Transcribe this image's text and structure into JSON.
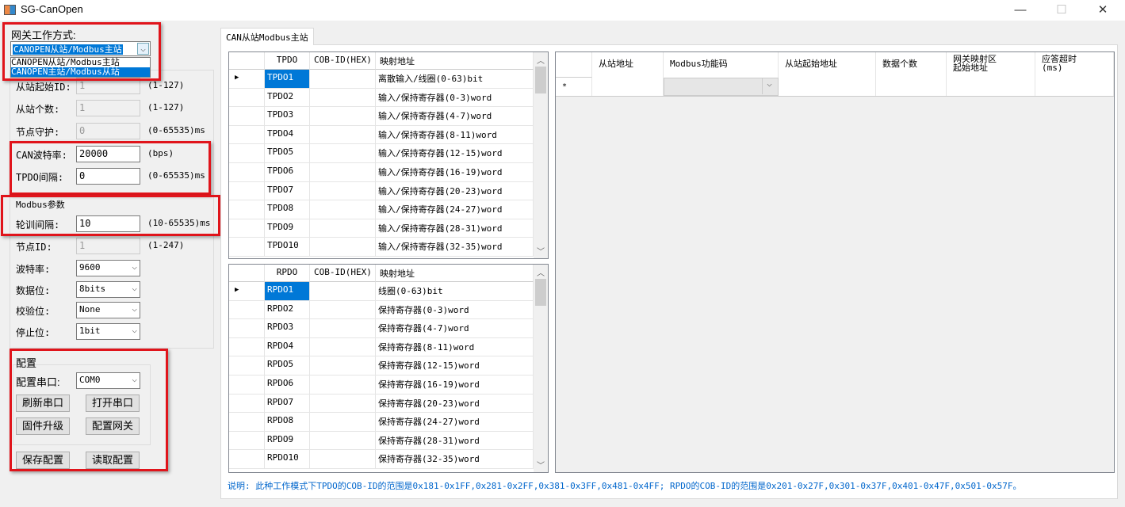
{
  "window": {
    "title": "SG-CanOpen",
    "minimize": "—",
    "maximize": "☐",
    "close": "✕"
  },
  "left": {
    "work_mode_label": "网关工作方式:",
    "work_mode_value": "CANOPEN从站/Modbus主站",
    "work_mode_options": [
      "CANOPEN从站/Modbus主站",
      "CANOPEN主站/Modbus从站"
    ],
    "can_fields": [
      {
        "label": "从站起始ID:",
        "value": "1",
        "range": "(1-127)",
        "disabled": true
      },
      {
        "label": "从站个数:",
        "value": "1",
        "range": "(1-127)",
        "disabled": true
      },
      {
        "label": "节点守护:",
        "value": "0",
        "range": "(0-65535)ms",
        "disabled": true
      },
      {
        "label": "CAN波特率:",
        "value": "20000",
        "range": "(bps)",
        "disabled": false
      },
      {
        "label": "TPDO间隔:",
        "value": "0",
        "range": "(0-65535)ms",
        "disabled": false
      }
    ],
    "modbus_title": "Modbus参数",
    "modbus_fields": [
      {
        "label": "轮训间隔:",
        "value": "10",
        "range": "(10-65535)ms",
        "disabled": false
      },
      {
        "label": "节点ID:",
        "value": "1",
        "range": "(1-247)",
        "disabled": true
      }
    ],
    "modbus_combos": [
      {
        "label": "波特率:",
        "value": "9600"
      },
      {
        "label": "数据位:",
        "value": "8bits"
      },
      {
        "label": "校验位:",
        "value": "None"
      },
      {
        "label": "停止位:",
        "value": "1bit"
      }
    ],
    "config": {
      "title": "配置",
      "port_label": "配置串口:",
      "port_value": "COM0",
      "refresh": "刷新串口",
      "open": "打开串口",
      "upgrade": "固件升级",
      "config_gateway": "配置网关",
      "save": "保存配置",
      "read": "读取配置"
    }
  },
  "tab": {
    "label": "CAN从站Modbus主站"
  },
  "tpdo": {
    "headers": [
      "TPDO",
      "COB-ID(HEX)",
      "映射地址"
    ],
    "rows": [
      [
        "TPDO1",
        "",
        "离散输入/线圈(0-63)bit"
      ],
      [
        "TPDO2",
        "",
        "输入/保持寄存器(0-3)word"
      ],
      [
        "TPDO3",
        "",
        "输入/保持寄存器(4-7)word"
      ],
      [
        "TPDO4",
        "",
        "输入/保持寄存器(8-11)word"
      ],
      [
        "TPDO5",
        "",
        "输入/保持寄存器(12-15)word"
      ],
      [
        "TPDO6",
        "",
        "输入/保持寄存器(16-19)word"
      ],
      [
        "TPDO7",
        "",
        "输入/保持寄存器(20-23)word"
      ],
      [
        "TPDO8",
        "",
        "输入/保持寄存器(24-27)word"
      ],
      [
        "TPDO9",
        "",
        "输入/保持寄存器(28-31)word"
      ],
      [
        "TPDO10",
        "",
        "输入/保持寄存器(32-35)word"
      ]
    ]
  },
  "rpdo": {
    "headers": [
      "RPDO",
      "COB-ID(HEX)",
      "映射地址"
    ],
    "rows": [
      [
        "RPDO1",
        "",
        "线圈(0-63)bit"
      ],
      [
        "RPDO2",
        "",
        "保持寄存器(0-3)word"
      ],
      [
        "RPDO3",
        "",
        "保持寄存器(4-7)word"
      ],
      [
        "RPDO4",
        "",
        "保持寄存器(8-11)word"
      ],
      [
        "RPDO5",
        "",
        "保持寄存器(12-15)word"
      ],
      [
        "RPDO6",
        "",
        "保持寄存器(16-19)word"
      ],
      [
        "RPDO7",
        "",
        "保持寄存器(20-23)word"
      ],
      [
        "RPDO8",
        "",
        "保持寄存器(24-27)word"
      ],
      [
        "RPDO9",
        "",
        "保持寄存器(28-31)word"
      ],
      [
        "RPDO10",
        "",
        "保持寄存器(32-35)word"
      ]
    ]
  },
  "modbus_grid": {
    "headers": [
      "从站地址",
      "Modbus功能码",
      "从站起始地址",
      "数据个数",
      "网关映射区\n起始地址",
      "应答超时\n(ms)"
    ],
    "new_row_marker": "*"
  },
  "note": "说明: 此种工作模式下TPDO的COB-ID的范围是0x181-0x1FF,0x281-0x2FF,0x381-0x3FF,0x481-0x4FF; RPDO的COB-ID的范围是0x201-0x27F,0x301-0x37F,0x401-0x47F,0x501-0x57F。",
  "colors": {
    "accent": "#0078d7",
    "highlight_box": "#e0141b",
    "note": "#0066cc"
  }
}
